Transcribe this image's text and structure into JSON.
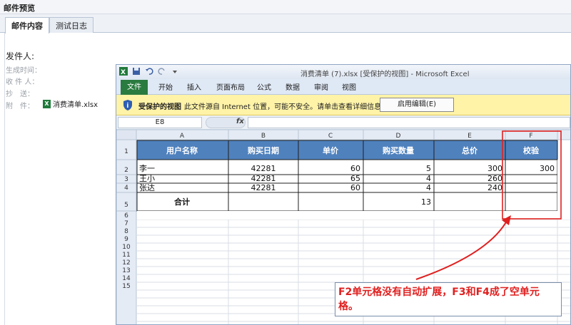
{
  "mail": {
    "window_title": "邮件预览",
    "tabs": [
      {
        "label": "邮件内容"
      },
      {
        "label": "测试日志"
      }
    ],
    "sender_label": "发件人:",
    "meta": {
      "sent_time": "生成时间：",
      "recipients": "收 件 人：",
      "cc": "抄　送：",
      "attach": "附　件："
    },
    "attachment_name": "消费清单.xlsx"
  },
  "excel": {
    "caption": "消费清单 (7).xlsx  [受保护的视图] - Microsoft Excel",
    "ribbon_tabs": [
      "文件",
      "开始",
      "插入",
      "页面布局",
      "公式",
      "数据",
      "审阅",
      "视图"
    ],
    "protected": {
      "title": "受保护的视图",
      "message": "此文件源自 Internet 位置，可能不安全。请单击查看详细信息。",
      "button": "启用编辑(E)"
    },
    "name_box": "E8",
    "fx": "fx",
    "columns": [
      "A",
      "B",
      "C",
      "D",
      "E",
      "F"
    ],
    "rows": [
      "1",
      "2",
      "3",
      "4",
      "5",
      "6",
      "7",
      "8",
      "9",
      "10",
      "11",
      "12",
      "13",
      "14",
      "15"
    ],
    "headers": [
      "用户名称",
      "购买日期",
      "单价",
      "购买数量",
      "总价",
      "校验"
    ],
    "data": [
      [
        "李一",
        "42281",
        "60",
        "5",
        "300",
        "300"
      ],
      [
        "王小",
        "42281",
        "65",
        "4",
        "260",
        ""
      ],
      [
        "张达",
        "42281",
        "60",
        "4",
        "240",
        ""
      ]
    ],
    "total_row": {
      "label": "合计",
      "qty": "13"
    }
  },
  "annotation": {
    "text": "F2单元格没有自动扩展，F3和F4成了空单元格。",
    "color": "#e02020"
  }
}
